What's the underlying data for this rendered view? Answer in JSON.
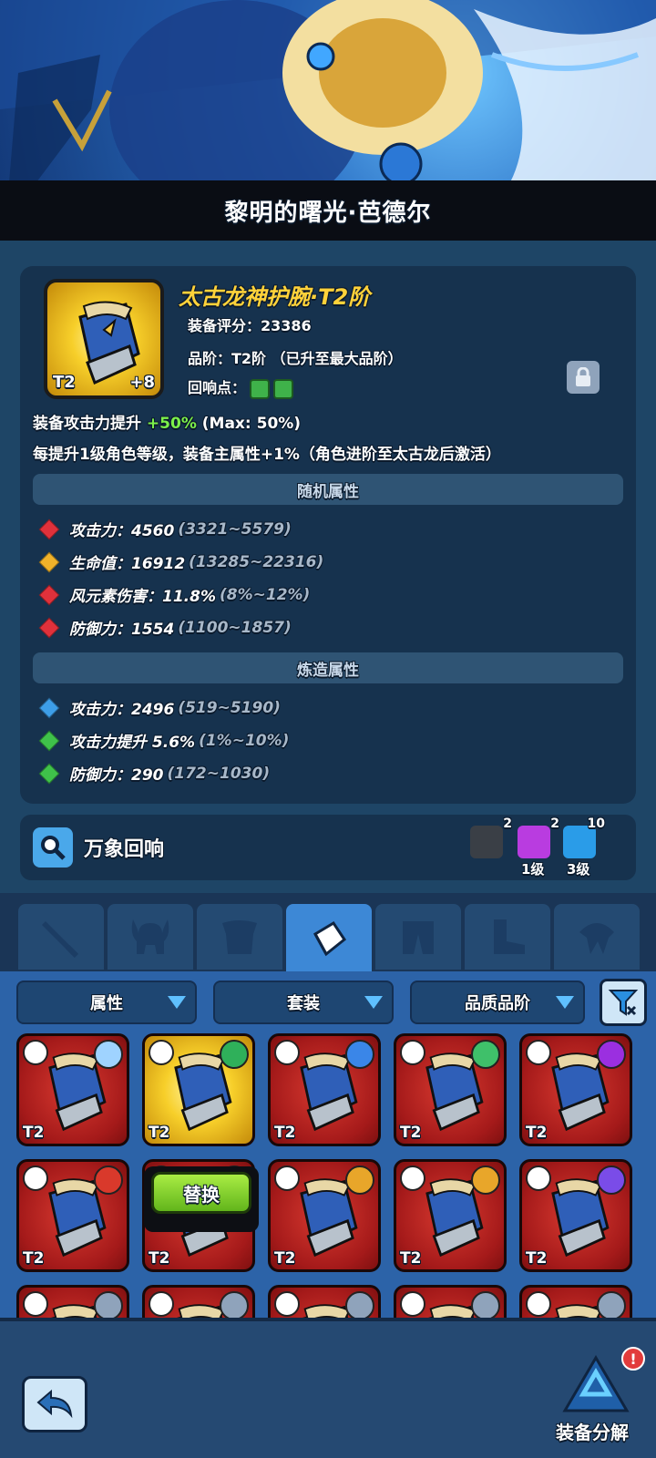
{
  "hero": {
    "title": "黎明的曙光·芭德尔"
  },
  "item": {
    "name": "太古龙神护腕·T2阶",
    "tier_badge": "T2",
    "enhance": "+8",
    "score": "装备评分：23386",
    "grade": "品阶：T2阶 （已升至最大品阶）",
    "echo_label": "回响点：",
    "desc1_prefix": "装备攻击力提升 ",
    "desc1_value": "+50%",
    "desc1_suffix": " (Max: 50%)",
    "desc2": "每提升1级角色等级，装备主属性+1%（角色进阶至太古龙后激活）"
  },
  "random_section": {
    "title": "随机属性",
    "attrs": [
      {
        "label": "攻击力：4560",
        "range": "(3321~5579)",
        "color": "#e0313b"
      },
      {
        "label": "生命值：16912",
        "range": "(13285~22316)",
        "color": "#f0b22a"
      },
      {
        "label": "风元素伤害：11.8%",
        "range": "(8%~12%)",
        "color": "#e0313b"
      },
      {
        "label": "防御力：1554",
        "range": "(1100~1857)",
        "color": "#e0313b"
      }
    ]
  },
  "forge_section": {
    "title": "炼造属性",
    "attrs": [
      {
        "label": "攻击力：2496",
        "range": "(519~5190)",
        "color": "#3d9ee8"
      },
      {
        "label": "攻击力提升 5.6%",
        "range": "(1%~10%)",
        "color": "#3fc24a"
      },
      {
        "label": "防御力：290",
        "range": "(172~1030)",
        "color": "#3fc24a"
      }
    ]
  },
  "echo": {
    "label": "万象回响",
    "gems": [
      {
        "count": "2",
        "level": "",
        "color": "#3a3f46"
      },
      {
        "count": "2",
        "level": "1级",
        "color": "#b93ce0"
      },
      {
        "count": "10",
        "level": "3级",
        "color": "#2a9ce8"
      }
    ]
  },
  "filters": {
    "attribute": "属性",
    "set": "套装",
    "quality": "品质品阶"
  },
  "slots": {
    "tier": "T2",
    "replace_label": "替换"
  },
  "bottom": {
    "salvage_label": "装备分解",
    "alert": "!"
  },
  "colors": {
    "accent_gold": "#ffd23a",
    "green": "#7cf04a",
    "tab_active": "#3d88d6"
  }
}
